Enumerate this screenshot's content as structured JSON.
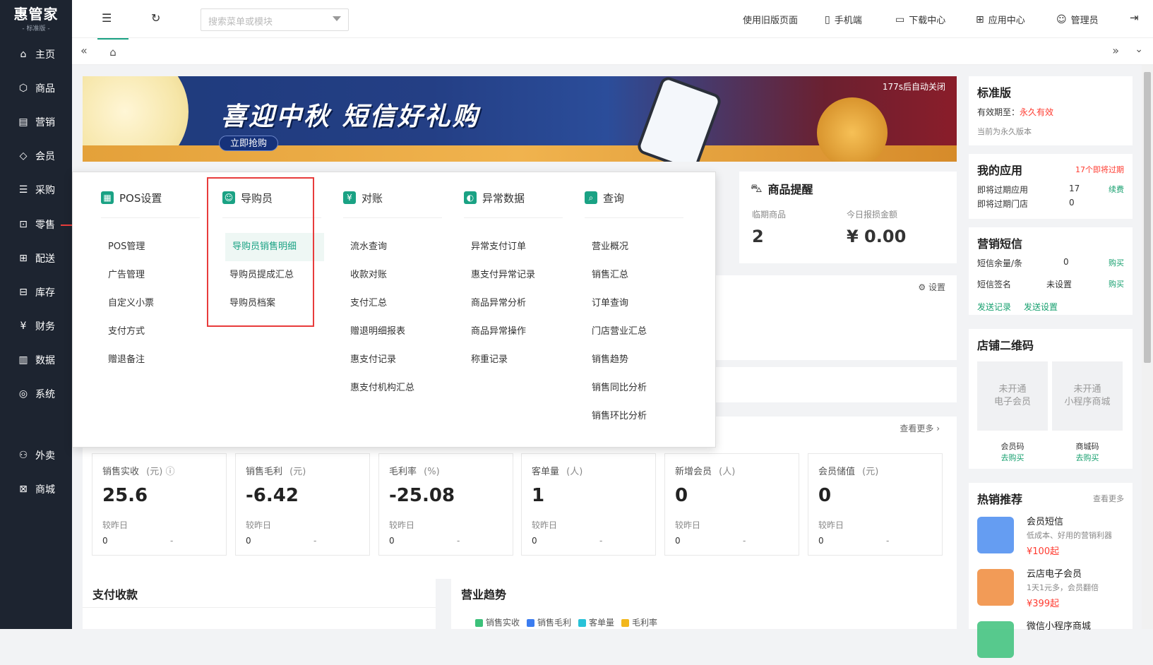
{
  "logo": {
    "name": "惠管家",
    "edition": "- 标准版 -"
  },
  "sidebar": [
    {
      "label": "主页",
      "icon": "home-icon",
      "glyph": "⌂"
    },
    {
      "label": "商品",
      "icon": "box-icon",
      "glyph": "⬡"
    },
    {
      "label": "营销",
      "icon": "chart-icon",
      "glyph": "▤"
    },
    {
      "label": "会员",
      "icon": "diamond-icon",
      "glyph": "◇"
    },
    {
      "label": "采购",
      "icon": "list-icon",
      "glyph": "☰"
    },
    {
      "label": "零售",
      "icon": "bag-icon",
      "glyph": "⊡"
    },
    {
      "label": "配送",
      "icon": "truck-icon",
      "glyph": "⊞"
    },
    {
      "label": "库存",
      "icon": "warehouse-icon",
      "glyph": "⊟"
    },
    {
      "label": "财务",
      "icon": "finance-icon",
      "glyph": "¥"
    },
    {
      "label": "数据",
      "icon": "data-icon",
      "glyph": "▥"
    },
    {
      "label": "系统",
      "icon": "settings-icon",
      "glyph": "◎"
    },
    {
      "label": "外卖",
      "icon": "delivery-icon",
      "glyph": "⚇"
    },
    {
      "label": "商城",
      "icon": "shop-icon",
      "glyph": "⊠"
    }
  ],
  "topbar": {
    "search_placeholder": "搜索菜单或模块",
    "links": [
      {
        "label": "使用旧版页面",
        "icon": ""
      },
      {
        "label": "手机端",
        "icon": "▯"
      },
      {
        "label": "下载中心",
        "icon": "▭"
      },
      {
        "label": "应用中心",
        "icon": "⊞"
      },
      {
        "label": "管理员",
        "icon": "☺"
      }
    ]
  },
  "banner": {
    "headline": "喜迎中秋  短信好礼购",
    "button": "立即抢购",
    "countdown": "177s后自动关闭"
  },
  "edition_card": {
    "title": "标准版",
    "expire_label": "有效期至：",
    "expire_value": "永久有效",
    "note": "当前为永久版本"
  },
  "my_apps": {
    "title": "我的应用",
    "badge": "17个即将过期",
    "rows": [
      {
        "label": "即将过期应用",
        "value": "17",
        "action": "续费"
      },
      {
        "label": "即将过期门店",
        "value": "0",
        "action": ""
      }
    ]
  },
  "sms": {
    "title": "营销短信",
    "rows": [
      {
        "label": "短信余量/条",
        "value": "0",
        "action": "购买"
      },
      {
        "label": "短信签名",
        "value": "未设置",
        "action": "购买"
      }
    ],
    "links": [
      "发送记录",
      "发送设置"
    ]
  },
  "qr": {
    "title": "店铺二维码",
    "items": [
      {
        "box": "未开通\n电子会员",
        "label": "会员码",
        "action": "去购买"
      },
      {
        "box": "未开通\n小程序商城",
        "label": "商城码",
        "action": "去购买"
      }
    ]
  },
  "hot": {
    "title": "热销推荐",
    "more": "查看更多",
    "items": [
      {
        "name": "会员短信",
        "desc": "低成本、好用的营销利器",
        "price": "¥100起"
      },
      {
        "name": "云店电子会员",
        "desc": "1天1元多，会员翻倍",
        "price": "¥399起"
      },
      {
        "name": "微信小程序商城",
        "desc": "",
        "price": ""
      }
    ]
  },
  "goods_alert": {
    "title": "商品提醒",
    "cols": [
      {
        "label": "临期商品",
        "value": "2"
      },
      {
        "label": "今日报损金额",
        "value": "¥ 0.00"
      }
    ]
  },
  "settings_label": "设置",
  "see_more": "查看更多",
  "stats": [
    {
      "label": "销售实收",
      "unit": "(元)",
      "value": "25.6",
      "cmp": "较昨日",
      "cmp_value": "0",
      "dash": "-"
    },
    {
      "label": "销售毛利",
      "unit": "(元)",
      "value": "-6.42",
      "cmp": "较昨日",
      "cmp_value": "0",
      "dash": "-"
    },
    {
      "label": "毛利率",
      "unit": "(%)",
      "value": "-25.08",
      "cmp": "较昨日",
      "cmp_value": "0",
      "dash": "-"
    },
    {
      "label": "客单量",
      "unit": "(人)",
      "value": "1",
      "cmp": "较昨日",
      "cmp_value": "0",
      "dash": "-"
    },
    {
      "label": "新增会员",
      "unit": "(人)",
      "value": "0",
      "cmp": "较昨日",
      "cmp_value": "0",
      "dash": "-"
    },
    {
      "label": "会员储值",
      "unit": "(元)",
      "value": "0",
      "cmp": "较昨日",
      "cmp_value": "0",
      "dash": "-"
    }
  ],
  "payment_title": "支付收款",
  "trend": {
    "title": "营业趋势",
    "legend": [
      {
        "name": "销售实收",
        "color": "#3cc17a"
      },
      {
        "name": "销售毛利",
        "color": "#3b7cf0"
      },
      {
        "name": "客单量",
        "color": "#28c2d8"
      },
      {
        "name": "毛利率",
        "color": "#f2b71c"
      }
    ]
  },
  "menu": {
    "columns": [
      {
        "head": "POS设置",
        "icon_color": "#1aa284",
        "items": [
          "POS管理",
          "广告管理",
          "自定义小票",
          "支付方式",
          "赠退备注"
        ]
      },
      {
        "head": "导购员",
        "icon_color": "#1aa284",
        "items": [
          "导购员销售明细",
          "导购员提成汇总",
          "导购员档案"
        ]
      },
      {
        "head": "对账",
        "icon_color": "#1aa284",
        "items": [
          "流水查询",
          "收款对账",
          "支付汇总",
          "赠退明细报表",
          "惠支付记录",
          "惠支付机构汇总"
        ]
      },
      {
        "head": "异常数据",
        "icon_color": "#1aa284",
        "items": [
          "异常支付订单",
          "惠支付异常记录",
          "商品异常分析",
          "商品异常操作",
          "称重记录"
        ]
      },
      {
        "head": "查询",
        "icon_color": "#1aa284",
        "items": [
          "营业概况",
          "销售汇总",
          "订单查询",
          "门店营业汇总",
          "销售趋势",
          "销售同比分析",
          "销售环比分析"
        ]
      }
    ]
  }
}
